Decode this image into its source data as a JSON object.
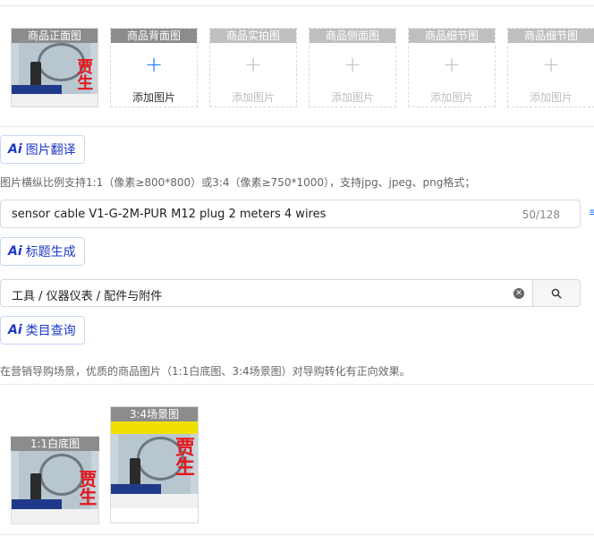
{
  "image_slots": [
    {
      "title": "商品正面图",
      "state": "filled"
    },
    {
      "title": "商品背面图",
      "state": "empty",
      "add_label": "添加图片"
    },
    {
      "title": "商品实拍图",
      "state": "disabled",
      "add_label": "添加图片"
    },
    {
      "title": "商品侧面图",
      "state": "disabled",
      "add_label": "添加图片"
    },
    {
      "title": "商品细节图",
      "state": "disabled",
      "add_label": "添加图片"
    },
    {
      "title": "商品细节图",
      "state": "disabled",
      "add_label": "添加图片"
    }
  ],
  "photo_overlay_text": "贾生",
  "ai_buttons": {
    "icon": "Ai",
    "image_translate": "图片翻译",
    "title_generate": "标题生成",
    "category_query": "类目查询"
  },
  "image_hint": "图片横纵比例支持1:1（像素≥800*800）或3:4（像素≥750*1000），支持jpg、jpeg、png格式；",
  "title_field": {
    "value": "sensor cable V1-G-2M-PUR M12 plug 2 meters 4 wires",
    "counter": "50/128"
  },
  "category_field": {
    "value": "工具 / 仪器仪表 / 配件与附件"
  },
  "scene_hint": "在营销导购场景，优质的商品图片（1:1白底图、3:4场景图）对导购转化有正向效果。",
  "scene_images": {
    "white_bg_label": "1:1白底图",
    "scene_label": "3:4场景图"
  },
  "icons": {
    "plus": "plus-icon",
    "clear": "clear-icon",
    "search": "search-icon"
  },
  "colors": {
    "accent": "#1677ff",
    "ai_text": "#1d39c4",
    "slot_header": "#8c8c8c"
  }
}
